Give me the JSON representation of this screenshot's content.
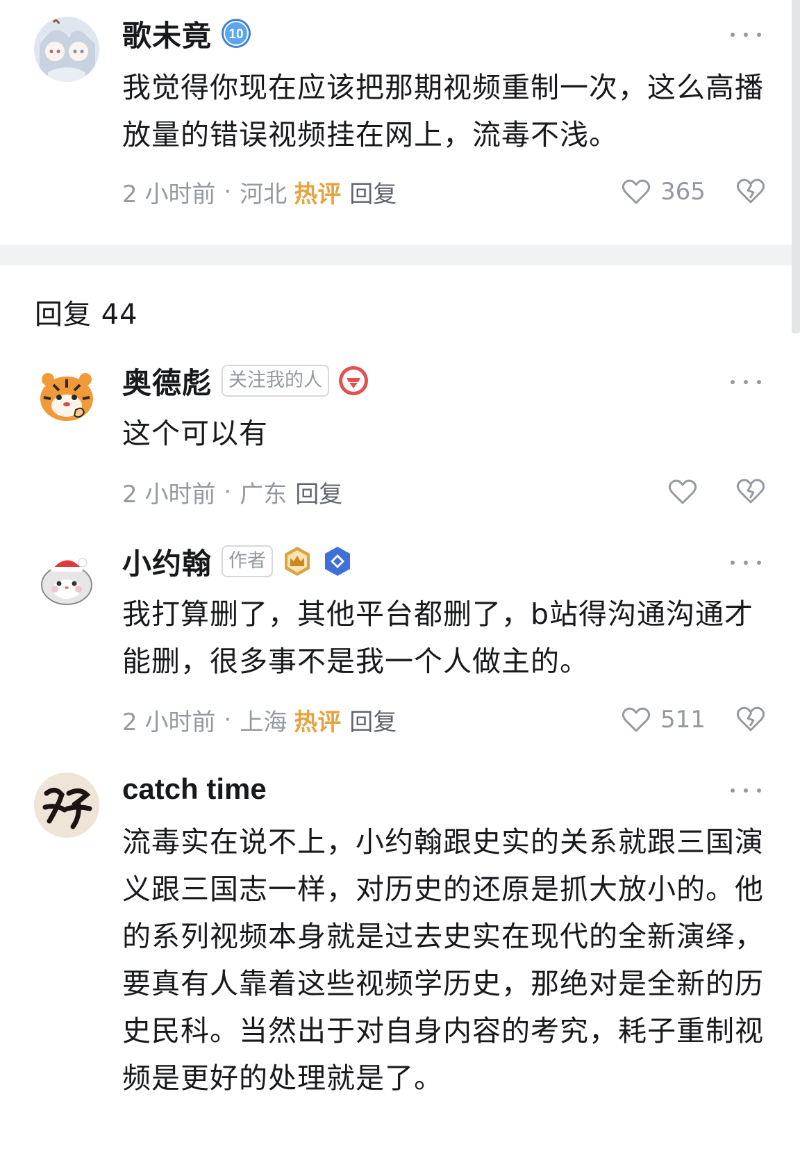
{
  "root_comment": {
    "username": "歌未竟",
    "level_badge": "10",
    "text": "我觉得你现在应该把那期视频重制一次，这么高播放量的错误视频挂在网上，流毒不浅。",
    "time": "2 小时前",
    "location": "河北",
    "hot_label": "热评",
    "reply_label": "回复",
    "likes": "365"
  },
  "replies_header": {
    "label": "回复 44"
  },
  "replies": [
    {
      "username": "奥德彪",
      "tag": "关注我的人",
      "text": "这个可以有",
      "time": "2 小时前",
      "location": "广东",
      "reply_label": "回复",
      "likes": ""
    },
    {
      "username": "小约翰",
      "tag": "作者",
      "text": "我打算删了，其他平台都删了，b站得沟通沟通才能删，很多事不是我一个人做主的。",
      "time": "2 小时前",
      "location": "上海",
      "hot_label": "热评",
      "reply_label": "回复",
      "likes": "511"
    },
    {
      "username": "catch time",
      "text": "流毒实在说不上，小约翰跟史实的关系就跟三国演义跟三国志一样，对历史的还原是抓大放小的。他的系列视频本身就是过去史实在现代的全新演绎，要真有人靠着这些视频学历史，那绝对是全新的历史民科。当然出于对自身内容的考究，耗子重制视频是更好的处理就是了。"
    }
  ],
  "colors": {
    "hot": "#e6a23c",
    "meta_gray": "#9499a0",
    "text": "#18191c",
    "divider": "#f1f2f3"
  },
  "icons": [
    "more-icon",
    "like-icon",
    "dislike-icon",
    "level-badge-icon",
    "fan-badge-icon",
    "crown-badge-icon",
    "verified-badge-icon"
  ]
}
